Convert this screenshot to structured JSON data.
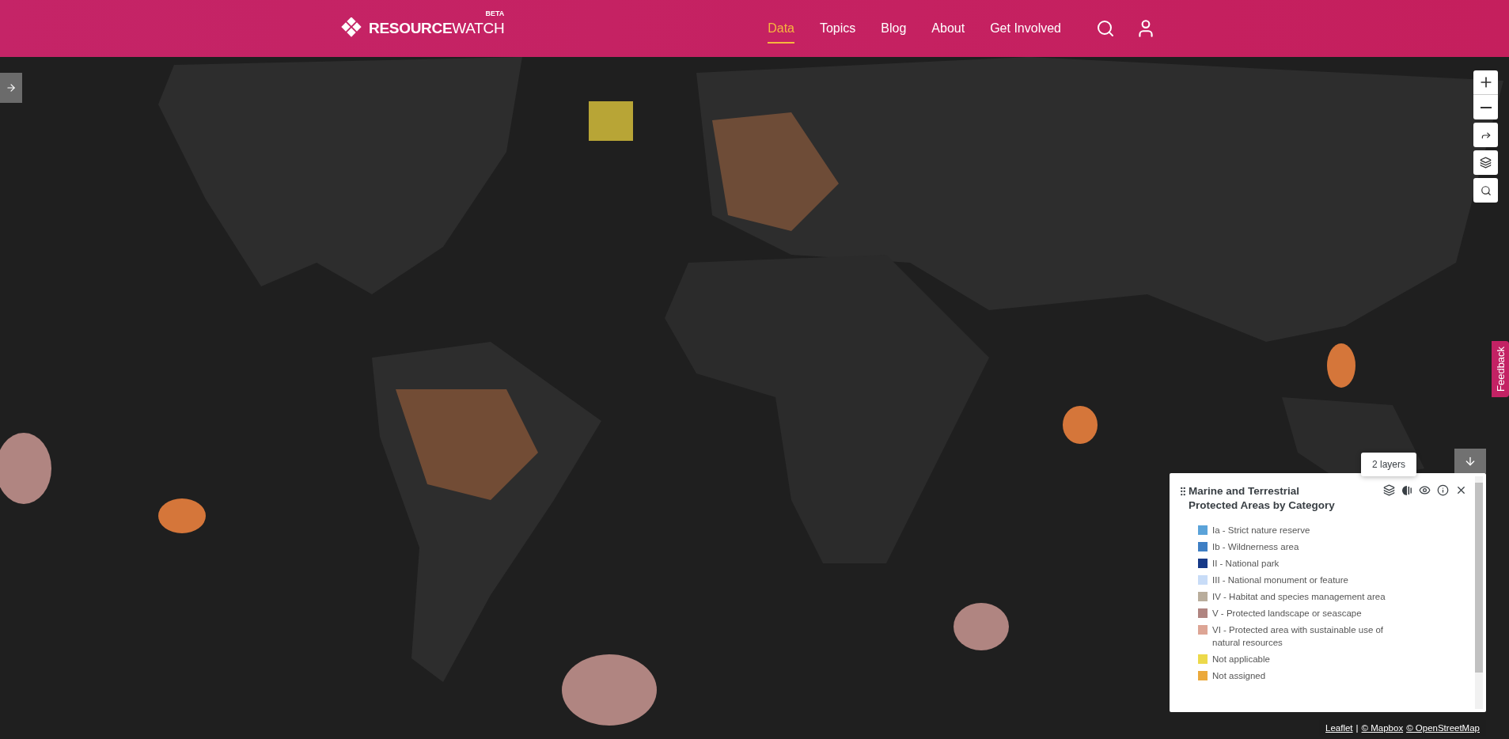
{
  "header": {
    "logo": "**RESOURCE**WATCH",
    "badge": "BETA",
    "nav": [
      {
        "label": "Data",
        "selected": true
      },
      {
        "label": "Topics",
        "selected": false
      },
      {
        "label": "Blog",
        "selected": false
      },
      {
        "label": "About",
        "selected": false
      },
      {
        "label": "Get Involved",
        "selected": false
      }
    ]
  },
  "feedback": "Feedback",
  "legend": {
    "title": "Marine and Terrestrial Protected Areas by Category",
    "tooltip": "2 layers",
    "items": [
      {
        "label": "Ia - Strict nature reserve",
        "color": "#5ba3d9"
      },
      {
        "label": "Ib - Wildnerness area",
        "color": "#3f7fc4"
      },
      {
        "label": "II - National park",
        "color": "#173a88"
      },
      {
        "label": "III - National monument or feature",
        "color": "#c8dcf7"
      },
      {
        "label": "IV - Habitat and species management area",
        "color": "#b9ad9c"
      },
      {
        "label": "V - Protected landscape or seascape",
        "color": "#b08581"
      },
      {
        "label": "VI - Protected area with sustainable use of natural resources",
        "color": "#dda595"
      },
      {
        "label": "Not applicable",
        "color": "#ecd94b"
      },
      {
        "label": "Not assigned",
        "color": "#eba93c"
      }
    ]
  },
  "attribution": {
    "links": [
      "Leaflet",
      "© Mapbox",
      "© OpenStreetMap"
    ],
    "separator": "|"
  }
}
